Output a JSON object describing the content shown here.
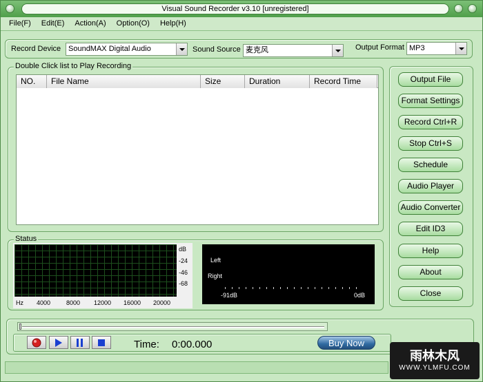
{
  "window": {
    "title": "Visual Sound Recorder v3.10  [unregistered]"
  },
  "menu": [
    "File(F)",
    "Edit(E)",
    "Action(A)",
    "Option(O)",
    "Help(H)"
  ],
  "settings": {
    "record_device_label": "Record Device",
    "record_device_value": "SoundMAX Digital Audio",
    "sound_source_label": "Sound Source",
    "sound_source_value": "麦克风",
    "output_format_label": "Output Format",
    "output_format_value": "MP3"
  },
  "recordings": {
    "legend": "Double Click list to Play Recording",
    "columns": [
      "NO.",
      "File Name",
      "Size",
      "Duration",
      "Record Time"
    ],
    "rows": []
  },
  "buttons": [
    "Output File",
    "Format Settings",
    "Record Ctrl+R",
    "Stop Ctrl+S",
    "Schedule",
    "Audio Player",
    "Audio Converter",
    "Edit ID3",
    "Help",
    "About",
    "Close"
  ],
  "status": {
    "legend": "Status",
    "db_labels": [
      "dB",
      "-24",
      "-46",
      "-68"
    ],
    "freq_labels": [
      "Hz",
      "4000",
      "8000",
      "12000",
      "16000",
      "20000"
    ],
    "meter_left": "Left",
    "meter_right": "Right",
    "meter_min": "-91dB",
    "meter_max": "0dB"
  },
  "transport": {
    "time_label": "Time:",
    "time_value": "0:00.000",
    "buy_now": "Buy Now"
  },
  "watermark": {
    "line1": "雨林木风",
    "line2": "WWW.YLMFU.COM"
  },
  "colors": {
    "frame": "#4f9f4a",
    "panel": "#c9e8c3",
    "button": "#a8dca0",
    "record": "#d62020",
    "play": "#1a3fd0"
  }
}
